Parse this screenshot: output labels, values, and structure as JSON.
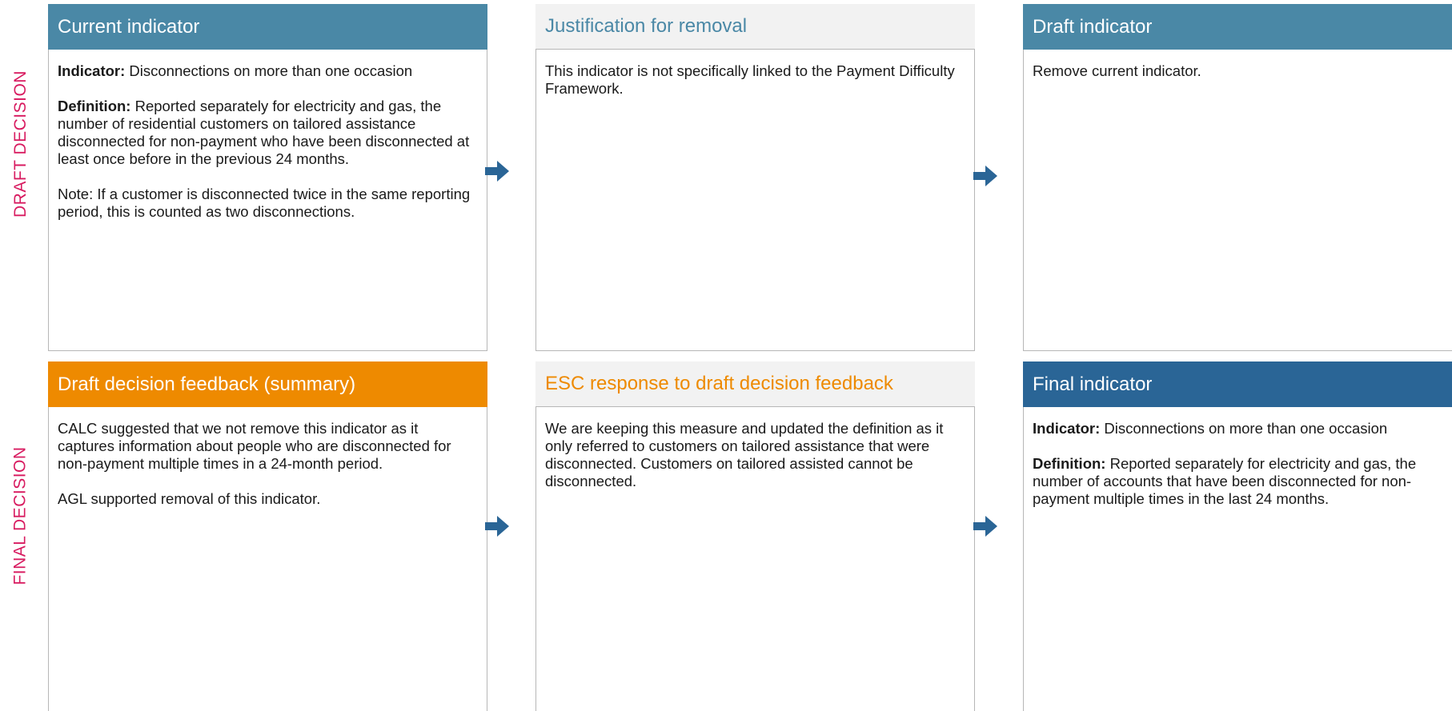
{
  "side_labels": {
    "draft": "DRAFT DECISION",
    "final": "FINAL DECISION"
  },
  "draft_row": {
    "current_indicator": {
      "title": "Current indicator",
      "indicator_label": "Indicator:",
      "indicator_text": " Disconnections on more than one occasion",
      "definition_label": "Definition:",
      "definition_text": " Reported separately for electricity and gas, the number of residential customers on tailored assistance disconnected for non-payment who have been disconnected at least once before in the previous 24 months.",
      "note": "Note: If a customer is disconnected twice in the same reporting period, this is counted as two disconnections."
    },
    "justification": {
      "title": "Justification for removal",
      "text": "This indicator is not specifically linked to the Payment Difficulty Framework."
    },
    "draft_indicator": {
      "title": "Draft indicator",
      "text": "Remove current indicator."
    }
  },
  "final_row": {
    "feedback": {
      "title": "Draft decision feedback (summary)",
      "paragraph1": "CALC suggested that we not remove this indicator as it captures information about people who are disconnected for non-payment multiple times in a 24-month period.",
      "paragraph2": "AGL supported removal of this indicator."
    },
    "esc_response": {
      "title": "ESC response to draft decision feedback",
      "text": "We are keeping this measure and updated the definition as it only referred to customers on tailored assistance that were disconnected. Customers on tailored assisted cannot be disconnected."
    },
    "final_indicator": {
      "title": "Final indicator",
      "indicator_label": "Indicator:",
      "indicator_text": " Disconnections on more than one occasion",
      "definition_label": "Definition:",
      "definition_text": " Reported separately for electricity and gas, the number of accounts that have been disconnected for non-payment multiple times in the last 24 months."
    }
  },
  "colors": {
    "teal_header": "#4a88a6",
    "orange_header": "#ee8a00",
    "blue_header": "#2a6596",
    "side_label": "#d81b60",
    "arrow": "#2a6596"
  },
  "icons": {
    "arrow": "right-arrow-icon"
  }
}
